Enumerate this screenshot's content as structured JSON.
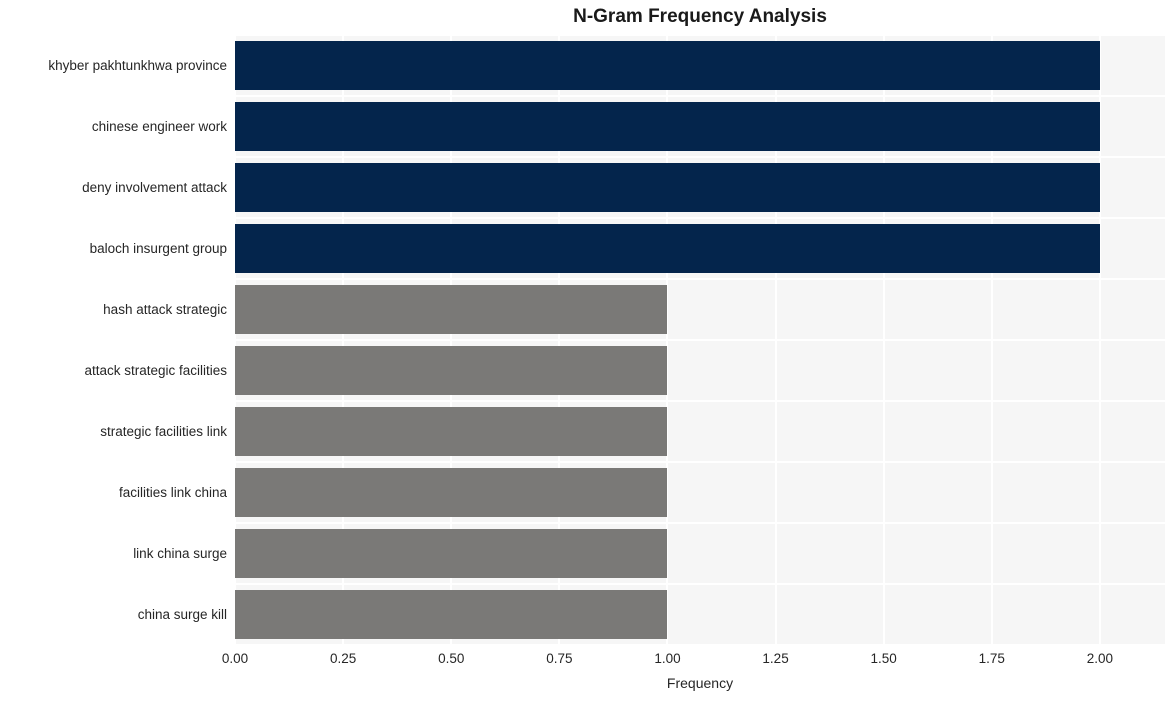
{
  "chart_data": {
    "type": "bar",
    "orientation": "horizontal",
    "title": "N-Gram Frequency Analysis",
    "xlabel": "Frequency",
    "ylabel": "",
    "xlim": [
      0,
      2.1505
    ],
    "xticks": [
      0,
      0.25,
      0.5,
      0.75,
      1.0,
      1.25,
      1.5,
      1.75,
      2.0
    ],
    "xticklabels": [
      "0.00",
      "0.25",
      "0.50",
      "0.75",
      "1.00",
      "1.25",
      "1.50",
      "1.75",
      "2.00"
    ],
    "grid": true,
    "grid_color": "#ffffff",
    "plot_bgcolor": "#f6f6f6",
    "legend": null,
    "categories": [
      "khyber pakhtunkhwa province",
      "chinese engineer work",
      "deny involvement attack",
      "baloch insurgent group",
      "hash attack strategic",
      "attack strategic facilities",
      "strategic facilities link",
      "facilities link china",
      "link china surge",
      "china surge kill"
    ],
    "values": [
      2,
      2,
      2,
      2,
      1,
      1,
      1,
      1,
      1,
      1
    ],
    "bar_colors": [
      "#04254c",
      "#04254c",
      "#04254c",
      "#04254c",
      "#7a7977",
      "#7a7977",
      "#7a7977",
      "#7a7977",
      "#7a7977",
      "#7a7977"
    ],
    "colors": {
      "high": "#04254c",
      "low": "#7a7977",
      "text": "#262626",
      "title": "#1a1a1a",
      "figure_background": "#ffffff"
    }
  }
}
